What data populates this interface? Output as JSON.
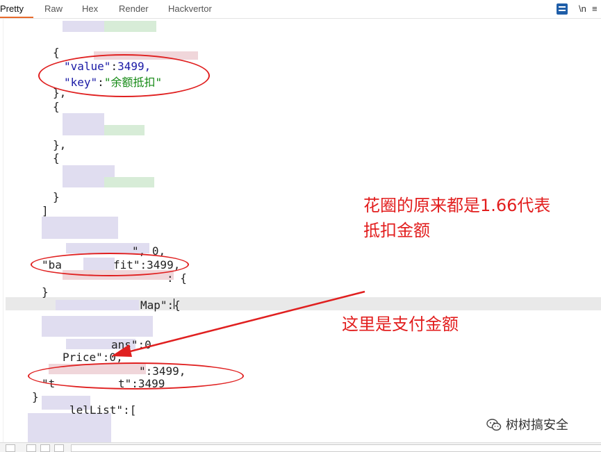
{
  "tabs": [
    {
      "label": "Pretty",
      "active": true
    },
    {
      "label": "Raw",
      "active": false
    },
    {
      "label": "Hex",
      "active": false
    },
    {
      "label": "Render",
      "active": false
    },
    {
      "label": "Hackvertor",
      "active": false
    }
  ],
  "toolbar": {
    "newline_toggle": "\\n",
    "menu": "≡"
  },
  "code": {
    "brace_open": "{",
    "brace_close_comma": "},",
    "brace_close": "}",
    "bracket_close": "]",
    "value_key": "\"value\"",
    "value_val": "3499,",
    "key_key": "\"key\"",
    "key_val": "\"余额抵扣\"",
    "colon": ":",
    "frag_zero": "\", 0,",
    "frag_fit": "fit\":3499,",
    "frag_ba": "\"ba",
    "frag_open_obj": ": {",
    "frag_map": "Map\":{",
    "frag_zero2": "ans\":0",
    "frag_price": "Price\":0,",
    "frag_3499c": "\":3499,",
    "frag_t": "\"t",
    "frag_3499": "t\":3499",
    "frag_list": "lelList\":["
  },
  "annotations": {
    "note1_line1": "花圈的原来都是1.66代表",
    "note1_line2": "抵扣金额",
    "note2": "这里是支付金额"
  },
  "watermark": {
    "text": "树树搞安全"
  },
  "colors": {
    "annotation": "#e21e1e",
    "tab_accent": "#e86a2b",
    "json_key": "#1a1aa6",
    "json_string": "#118811"
  }
}
